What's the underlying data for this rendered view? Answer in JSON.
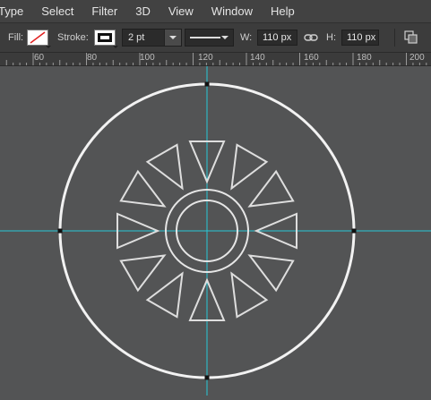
{
  "menu": [
    "Type",
    "Select",
    "Filter",
    "3D",
    "View",
    "Window",
    "Help"
  ],
  "options": {
    "fill_label": "Fill:",
    "stroke_label": "Stroke:",
    "stroke_width": "2 pt",
    "w_label": "W:",
    "w_value": "110 px",
    "h_label": "H:",
    "h_value": "110 px"
  },
  "ruler": {
    "ticks": [
      "60",
      "80",
      "100",
      "120",
      "140",
      "160",
      "180",
      "200"
    ]
  },
  "colors": {
    "guide": "#27c7d6",
    "shape_stroke": "#ffffff",
    "canvas_bg": "#535455",
    "fill_none_slash": "#e02020"
  },
  "icons": [
    "link-icon",
    "path-arrange-icon",
    "stroke-line-style-icon"
  ]
}
